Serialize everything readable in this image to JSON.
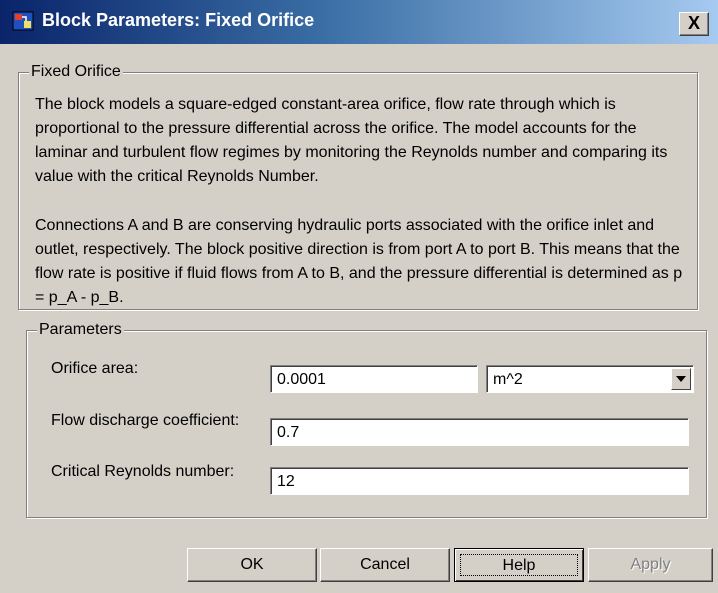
{
  "window": {
    "title": "Block Parameters: Fixed Orifice",
    "close_label": "X"
  },
  "description": {
    "group_title": "Fixed Orifice",
    "paragraph1": "The block models a square-edged constant-area orifice, flow rate through which is proportional to the pressure differential across the orifice. The model accounts for the laminar and turbulent flow regimes by monitoring the Reynolds number and comparing its value with the critical Reynolds Number.",
    "paragraph2": "Connections A and B are conserving hydraulic ports associated with the orifice inlet and outlet, respectively. The block positive direction is from port A to port B. This means that the flow rate is positive if fluid flows from A to B, and the pressure differential is determined as p = p_A - p_B."
  },
  "parameters": {
    "group_title": "Parameters",
    "orifice_area": {
      "label": "Orifice area:",
      "value": "0.0001",
      "unit": "m^2"
    },
    "discharge_coefficient": {
      "label": "Flow discharge coefficient:",
      "value": "0.7"
    },
    "critical_reynolds": {
      "label": "Critical Reynolds number:",
      "value": "12"
    }
  },
  "buttons": {
    "ok": "OK",
    "cancel": "Cancel",
    "help": "Help",
    "apply": "Apply"
  }
}
